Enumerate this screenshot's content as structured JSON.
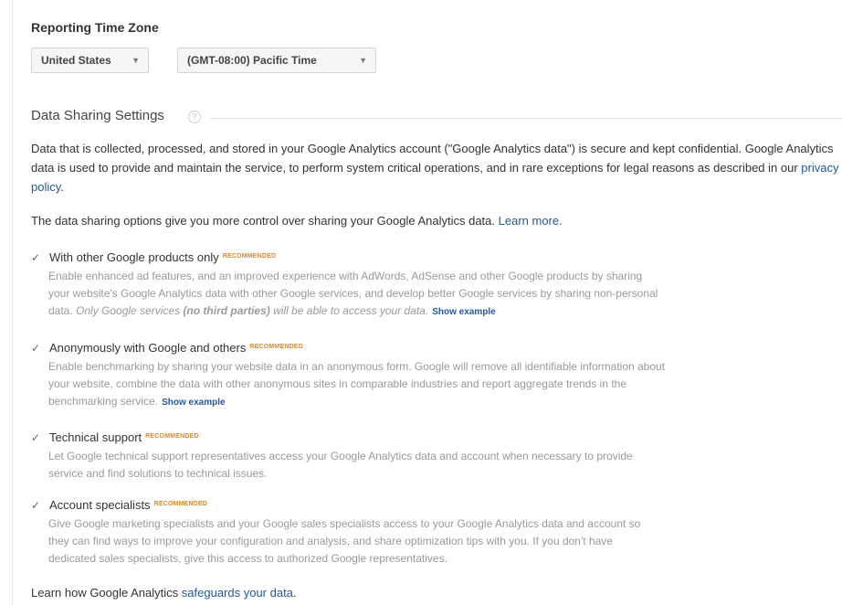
{
  "reporting": {
    "label": "Reporting Time Zone",
    "country_value": "United States",
    "timezone_value": "(GMT-08:00) Pacific Time"
  },
  "data_sharing": {
    "title": "Data Sharing Settings",
    "intro_pre": "Data that is collected, processed, and stored in your Google Analytics account (\"Google Analytics data\") is secure and kept confidential. Google Analytics data is used to provide and maintain the service, to perform system critical operations, and in rare exceptions for legal reasons as described in our ",
    "intro_link": "privacy policy",
    "intro_post": ".",
    "options_text": "The data sharing options give you more control over sharing your Google Analytics data. ",
    "learn_more": "Learn more."
  },
  "recommended_badge": "RECOMMENDED",
  "show_example": "Show example",
  "options": [
    {
      "title": "With other Google products only",
      "checked": true,
      "line1": "Enable enhanced ad features, and an improved experience with AdWords, AdSense and other Google products by sharing",
      "line2": "your website's Google Analytics data with other Google services, and develop better Google services by sharing non-personal",
      "line3_pre": "data. ",
      "line3_ital": "Only Google services ",
      "line3_bold": "(no third parties)",
      "line3_ital2": " will be able to access your data."
    },
    {
      "title": "Anonymously with Google and others",
      "checked": true,
      "line1": "Enable benchmarking by sharing your website data in an anonymous form. Google will remove all identifiable information about",
      "line2": "your website, combine the data with other anonymous sites in comparable industries and report aggregate trends in the",
      "line3": "benchmarking service."
    },
    {
      "title": "Technical support",
      "checked": true,
      "line1": "Let Google technical support representatives access your Google Analytics data and account when necessary to provide",
      "line2": "service and find solutions to technical issues."
    },
    {
      "title": "Account specialists",
      "checked": true,
      "line1": "Give Google marketing specialists and your Google sales specialists access to your Google Analytics data and account so",
      "line2": "they can find ways to improve your configuration and analysis, and share optimization tips with you. If you don't have",
      "line3": "dedicated sales specialists, give this access to authorized Google representatives."
    }
  ],
  "footer": {
    "pre": "Learn how Google Analytics ",
    "link": "safeguards your data",
    "post": "."
  },
  "icons": {
    "check": "checkmark-icon",
    "help": "help-icon",
    "dropdown": "dropdown-arrow-icon"
  },
  "colors": {
    "link": "#2159a8",
    "badge": "#e08a22",
    "muted_text": "#9a9a9a"
  }
}
